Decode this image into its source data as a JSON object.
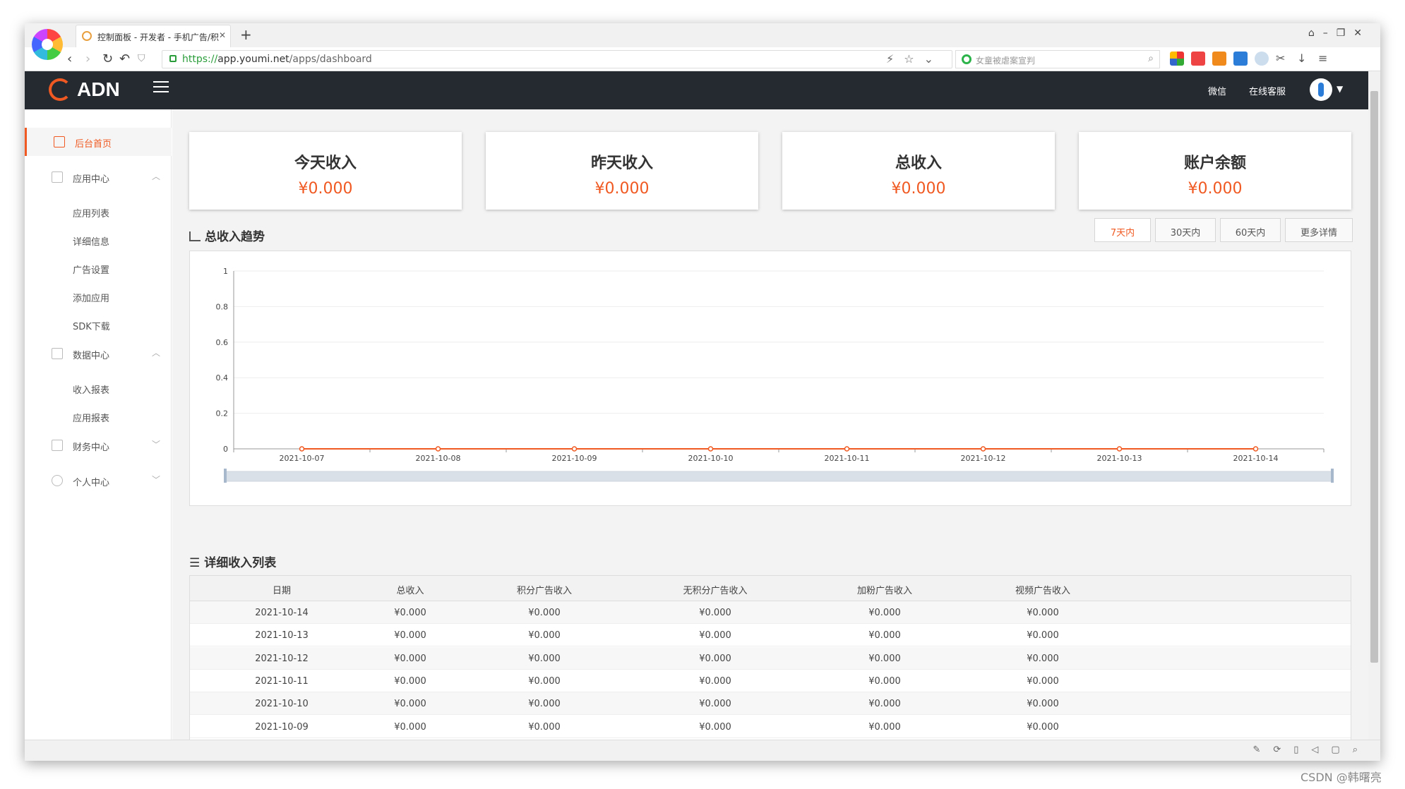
{
  "browser": {
    "tab_title": "控制面板 - 开发者 - 手机广告/积",
    "new_tab": "+",
    "url_protocol": "https://",
    "url_host": "app.youmi.net",
    "url_path": "/apps/dashboard",
    "search_placeholder": "女童被虐案宣判"
  },
  "header": {
    "brand": "ADN",
    "links": [
      "微信",
      "在线客服"
    ]
  },
  "sidebar": {
    "home": "后台首页",
    "app_center": "应用中心",
    "app_sub": [
      "应用列表",
      "详细信息",
      "广告设置",
      "添加应用",
      "SDK下载"
    ],
    "data_center": "数据中心",
    "data_sub": [
      "收入报表",
      "应用报表"
    ],
    "finance_center": "财务中心",
    "personal_center": "个人中心"
  },
  "cards": [
    {
      "title": "今天收入",
      "value": "¥0.000"
    },
    {
      "title": "昨天收入",
      "value": "¥0.000"
    },
    {
      "title": "总收入",
      "value": "¥0.000"
    },
    {
      "title": "账户余额",
      "value": "¥0.000"
    }
  ],
  "trend": {
    "title": "总收入趋势",
    "ranges": [
      "7天内",
      "30天内",
      "60天内",
      "更多详情"
    ],
    "active_range": "7天内"
  },
  "chart_data": {
    "type": "line",
    "x": [
      "2021-10-07",
      "2021-10-08",
      "2021-10-09",
      "2021-10-10",
      "2021-10-11",
      "2021-10-12",
      "2021-10-13",
      "2021-10-14"
    ],
    "series": [
      {
        "values": [
          0,
          0,
          0,
          0,
          0,
          0,
          0,
          0
        ],
        "color": "#f05a22"
      }
    ],
    "ylim": [
      0,
      1
    ],
    "yticks": [
      "0",
      "0.2",
      "0.4",
      "0.6",
      "0.8",
      "1"
    ],
    "grid": true
  },
  "table": {
    "title": "详细收入列表",
    "headers": [
      "日期",
      "总收入",
      "积分广告收入",
      "无积分广告收入",
      "加粉广告收入",
      "视频广告收入"
    ],
    "rows": [
      [
        "2021-10-14",
        "¥0.000",
        "¥0.000",
        "¥0.000",
        "¥0.000",
        "¥0.000"
      ],
      [
        "2021-10-13",
        "¥0.000",
        "¥0.000",
        "¥0.000",
        "¥0.000",
        "¥0.000"
      ],
      [
        "2021-10-12",
        "¥0.000",
        "¥0.000",
        "¥0.000",
        "¥0.000",
        "¥0.000"
      ],
      [
        "2021-10-11",
        "¥0.000",
        "¥0.000",
        "¥0.000",
        "¥0.000",
        "¥0.000"
      ],
      [
        "2021-10-10",
        "¥0.000",
        "¥0.000",
        "¥0.000",
        "¥0.000",
        "¥0.000"
      ],
      [
        "2021-10-09",
        "¥0.000",
        "¥0.000",
        "¥0.000",
        "¥0.000",
        "¥0.000"
      ]
    ]
  },
  "watermark": "CSDN @韩曙亮",
  "colors": {
    "accent": "#f05a22",
    "header_bg": "#252a31"
  }
}
